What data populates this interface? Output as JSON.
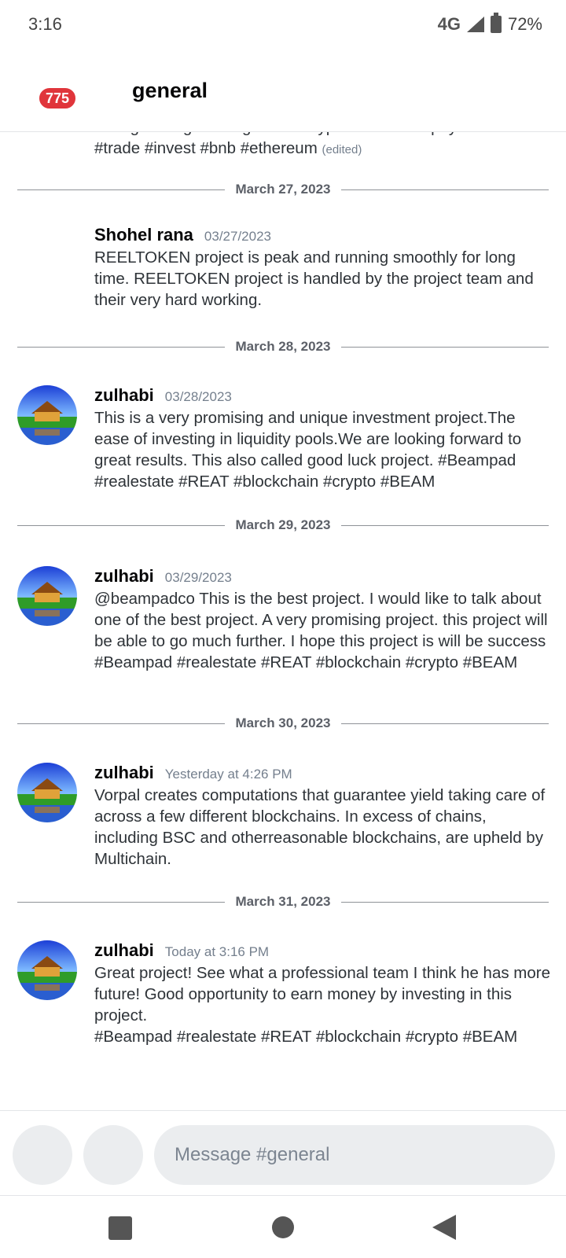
{
  "status_bar": {
    "time": "3:16",
    "network": "4G",
    "battery": "72%"
  },
  "header": {
    "badge_count": "775",
    "channel_name": "general"
  },
  "clipped_message": {
    "partial_line": "strengthening existing offers. crypto #AMC? #ApayBack",
    "text": "#trade #invest #bnb #ethereum",
    "edited": "(edited)"
  },
  "dividers": [
    "March 27, 2023",
    "March 28, 2023",
    "March 29, 2023",
    "March 30, 2023",
    "March 31, 2023"
  ],
  "messages": [
    {
      "author": "Shohel rana",
      "timestamp": "03/27/2023",
      "text": "REELTOKEN project is peak and running smoothly for long time. REELTOKEN project is handled by the project team and their very hard working."
    },
    {
      "author": "zulhabi",
      "timestamp": "03/28/2023",
      "text": "This is a very promising and unique investment project.The ease of investing in liquidity pools.We are looking forward to great results. This also called  good luck project. #Beampad #realestate #REAT #blockchain #crypto #BEAM"
    },
    {
      "author": "zulhabi",
      "timestamp": "03/29/2023",
      "text": "@beampadco This is the best project. I would like to talk about one of the best project. A very promising project. this project will be able to go much further. I hope this project is will be success #Beampad #realestate #REAT #blockchain #crypto #BEAM"
    },
    {
      "author": "zulhabi",
      "timestamp": "Yesterday at 4:26 PM",
      "text": "Vorpal creates computations that guarantee yield taking care of across a few different blockchains. In excess of chains, including BSC and otherreasonable blockchains, are upheld by Multichain."
    },
    {
      "author": "zulhabi",
      "timestamp": "Today at 3:16 PM",
      "text": "Great project! See what a professional team I think he has more future! Good opportunity to earn money by investing in this project.",
      "text_line2": "#Beampad #realestate #REAT #blockchain #crypto #BEAM"
    }
  ],
  "composer": {
    "placeholder": "Message #general"
  },
  "colors": {
    "badge": "#e0353b",
    "text": "#2e3338",
    "muted": "#747f8d",
    "input_bg": "#ebedef"
  }
}
